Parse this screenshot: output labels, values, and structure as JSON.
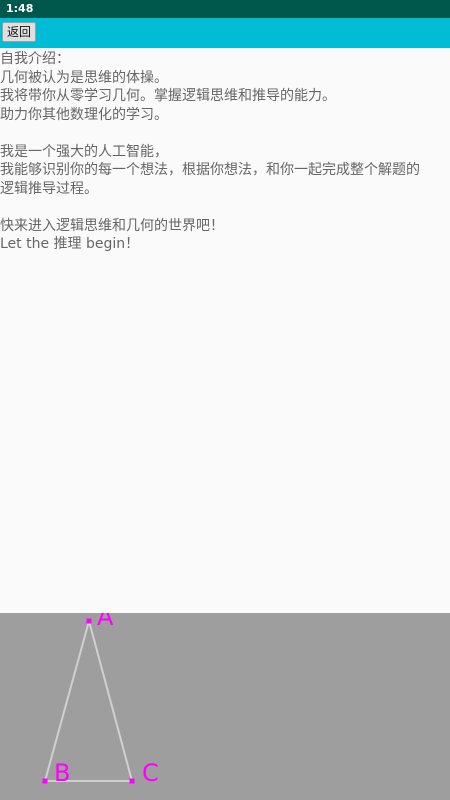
{
  "status_bar": {
    "time": "1:48"
  },
  "toolbar": {
    "back_label": "返回"
  },
  "intro": {
    "lines": [
      "自我介绍：",
      "几何被认为是思维的体操。",
      "我将带你从零学习几何。掌握逻辑思维和推导的能力。",
      "助力你其他数理化的学习。",
      "",
      "我是一个强大的人工智能，",
      "我能够识别你的每一个想法，根据你想法，和你一起完成整个解题的",
      "逻辑推导过程。",
      "",
      "快来进入逻辑思维和几何的世界吧！",
      "Let the 推理 begin！"
    ]
  },
  "canvas": {
    "background_color": "#9e9e9e",
    "line_color": "#d0d0d0",
    "point_color": "#ff00ff",
    "label_color": "#ff00ff",
    "points": [
      {
        "label": "A"
      },
      {
        "label": "B"
      },
      {
        "label": "C"
      }
    ]
  }
}
